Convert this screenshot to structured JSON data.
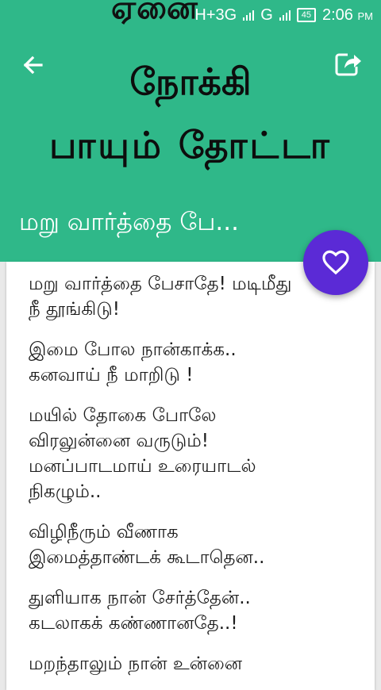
{
  "status_bar": {
    "background_text": "ஏனை",
    "network": "H+3G",
    "network2": "G",
    "battery": "45",
    "time": "2:06",
    "ampm": "PM"
  },
  "app_bar": {
    "logo_line1": "நோக்கி",
    "logo_line2": "பாயும் தோட்டா",
    "title": "மறு வார்த்தை பே...",
    "back_icon": "arrow-back-icon",
    "share_icon": "share-icon",
    "color": "#2fb889"
  },
  "fab": {
    "icon": "heart-icon",
    "color": "#5b2ad6"
  },
  "lyrics": {
    "stanzas": [
      [
        "மறு வார்த்தை பேசாதே! மடிமீது",
        "நீ தூங்கிடு!"
      ],
      [
        "இமை போல நான்காக்க..",
        "கனவாய் நீ மாறிடு !"
      ],
      [
        "மயில் தோகை போலே",
        "விரலுன்னை வருடும்!",
        "மனப்பாடமாய் உரையாடல்",
        "நிகழும்.."
      ],
      [
        "விழிநீரும் வீணாக",
        "இமைத்தாண்டக் கூடாதென.."
      ],
      [
        "துளியாக நான் சேர்த்தேன்..",
        "கடலாகக் கண்ணானதே..!"
      ],
      [
        "மறந்தாலும் நான் உன்னை"
      ]
    ]
  }
}
